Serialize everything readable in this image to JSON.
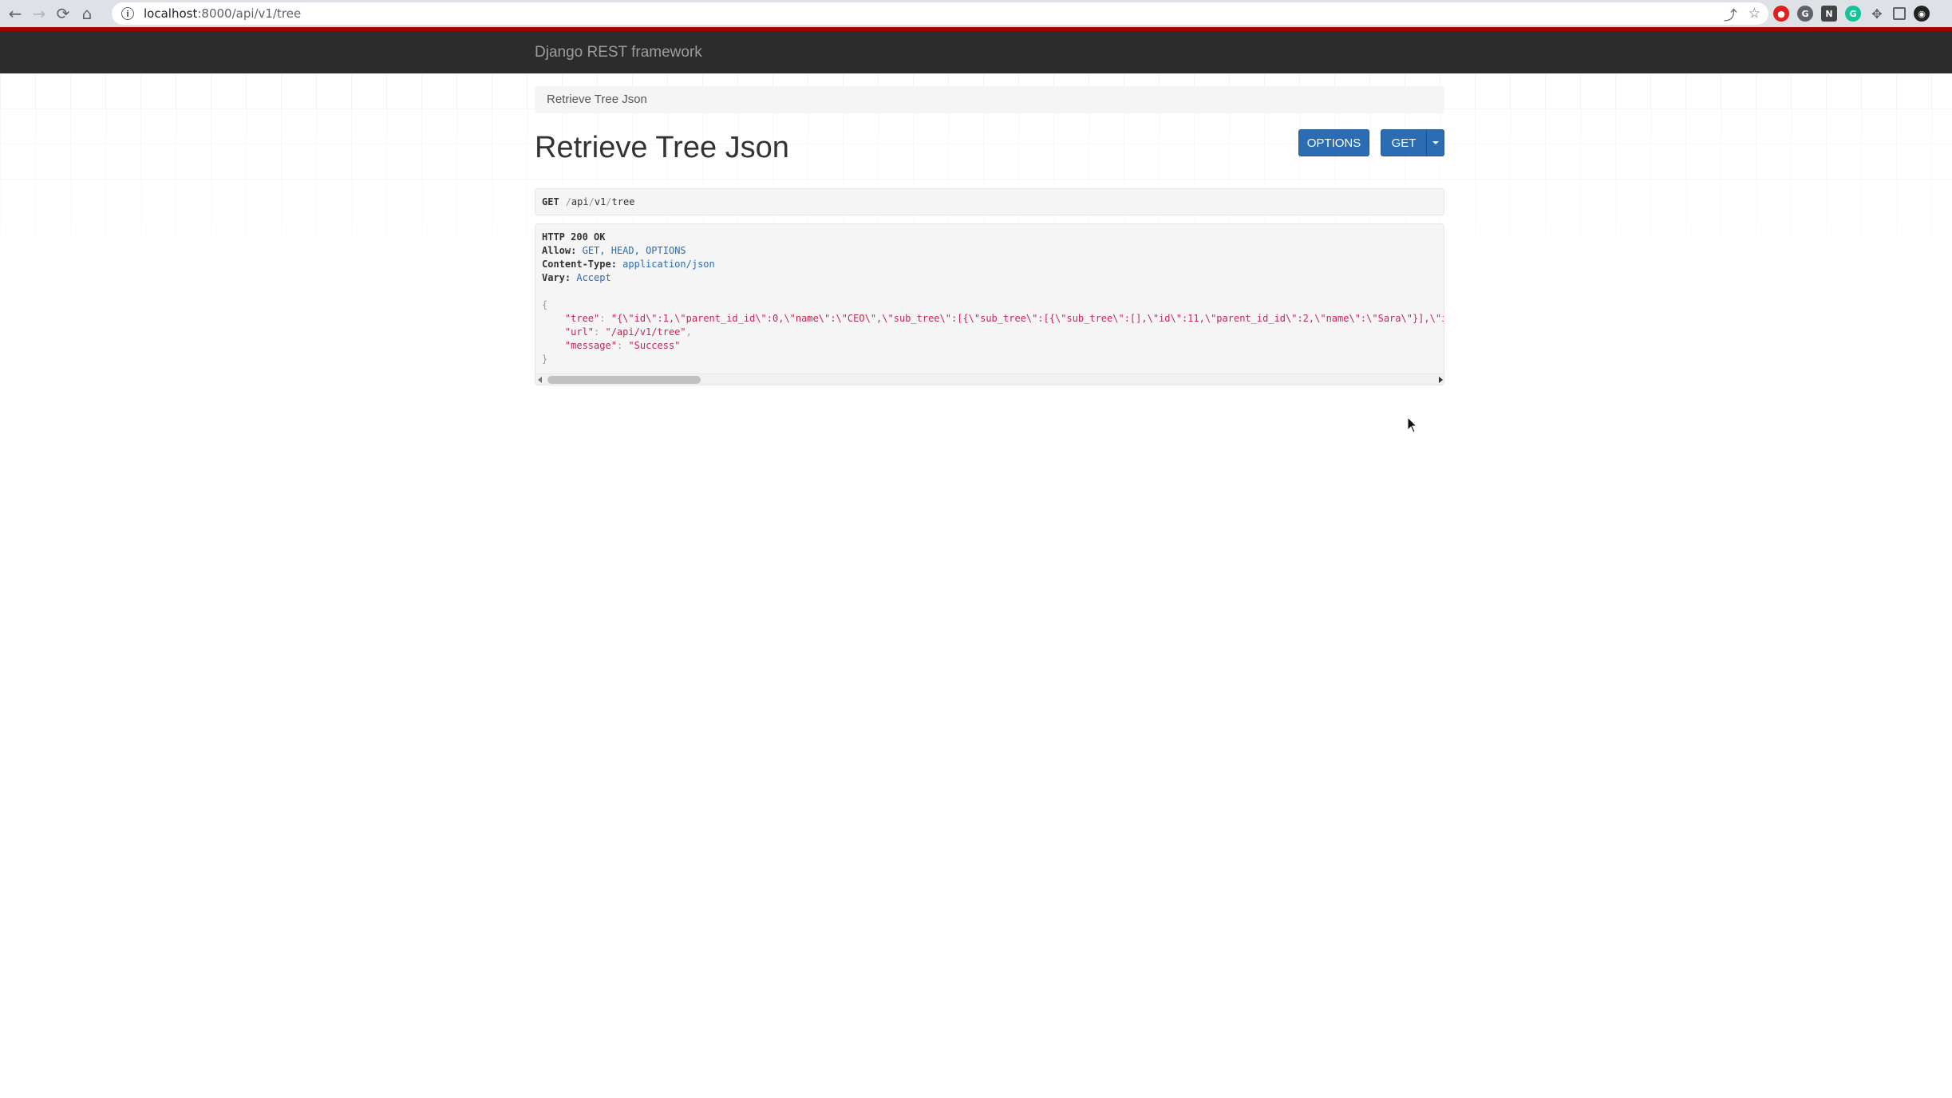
{
  "browser": {
    "url_host": "localhost",
    "url_rest": ":8000/api/v1/tree",
    "back_icon": "arrow-left-icon",
    "forward_icon": "arrow-right-icon",
    "reload_icon": "reload-icon",
    "home_icon": "home-icon"
  },
  "navbar": {
    "brand": "Django REST framework",
    "accent_color": "#a30000"
  },
  "breadcrumb": {
    "label": "Retrieve Tree Json"
  },
  "page": {
    "title": "Retrieve Tree Json",
    "options_label": "OPTIONS",
    "get_label": "GET"
  },
  "request": {
    "method": "GET",
    "path_parts": [
      "api",
      "v1",
      "tree"
    ]
  },
  "response": {
    "status": "HTTP 200 OK",
    "headers": [
      {
        "name": "Allow:",
        "value": "GET, HEAD, OPTIONS"
      },
      {
        "name": "Content-Type:",
        "value": "application/json"
      },
      {
        "name": "Vary:",
        "value": "Accept"
      }
    ],
    "body": {
      "open": "{",
      "close": "}",
      "fields": [
        {
          "key": "\"tree\"",
          "value": "\"{\\\"id\\\":1,\\\"parent_id_id\\\":0,\\\"name\\\":\\\"CEO\\\",\\\"sub_tree\\\":[{\\\"sub_tree\\\":[{\\\"sub_tree\\\":[],\\\"id\\\":11,\\\"parent_id_id\\\":2,\\\"name\\\":\\\"Sara\\\"}],\\\"i",
          "comma": ","
        },
        {
          "key": "\"url\"",
          "value": "\"/api/v1/tree\"",
          "comma": ","
        },
        {
          "key": "\"message\"",
          "value": "\"Success\"",
          "comma": ""
        }
      ]
    }
  }
}
